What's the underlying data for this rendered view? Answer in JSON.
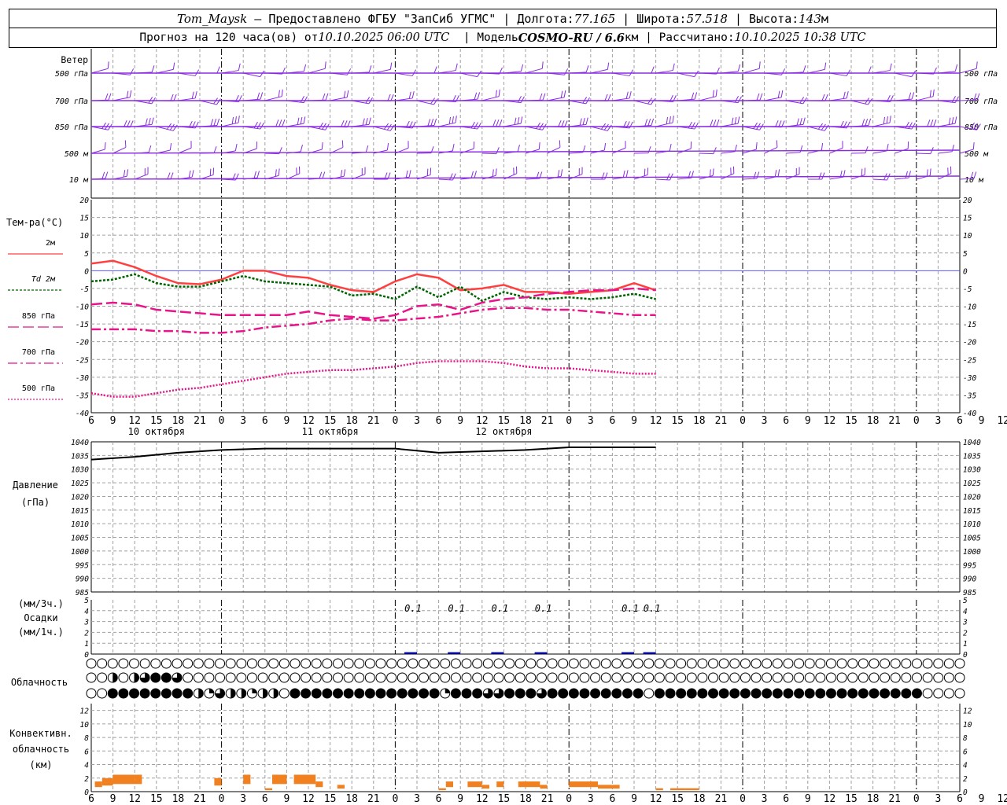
{
  "header": {
    "station": "Tom_Maysk",
    "provider": "Предоставлено ФГБУ \"ЗапСиб УГМС\"",
    "lon_label": "Долгота:",
    "lon": "77.165",
    "lat_label": "Широта:",
    "lat": "57.518",
    "alt_label": "Высота:",
    "alt": "143",
    "alt_unit": "м",
    "forecast_prefix": "Прогноз на 120 часа(ов) от",
    "forecast_time": "10.10.2025 06:00 UTC",
    "model_label": "Модель",
    "model": "COSMO-RU / 6.6",
    "model_unit": "км",
    "calc_label": "Рассчитано:",
    "calc_time": "10.10.2025 10:38 UTC"
  },
  "colors": {
    "wind": "#8a2be2",
    "t2m": "#ff4040",
    "td2m": "#006400",
    "t850": "#e8158a",
    "t700": "#e8158a",
    "t500": "#e8158a",
    "pressure": "#000000",
    "grid": "#a0a0a0",
    "zero_line": "#4040ff",
    "precip": "#0000c0",
    "convective": "#f08020"
  },
  "x_axis": {
    "start_hour": 6,
    "step_hours": 3,
    "total_hours": 120,
    "tick_labels": [
      "6",
      "9",
      "12",
      "15",
      "18",
      "21",
      "0",
      "3",
      "6",
      "9",
      "12",
      "15",
      "18",
      "21",
      "0",
      "3",
      "6",
      "9",
      "12",
      "15",
      "18",
      "21",
      "0",
      "3",
      "6",
      "9",
      "12",
      "15",
      "18",
      "21",
      "0",
      "3",
      "6",
      "9",
      "12",
      "15",
      "18",
      "21",
      "0",
      "3",
      "6",
      "9",
      "12"
    ],
    "day_labels": [
      {
        "text": "10 октября",
        "hour": 9
      },
      {
        "text": "11 октября",
        "hour": 33
      },
      {
        "text": "12 октября",
        "hour": 57
      }
    ]
  },
  "wind_panel": {
    "title": "Ветер",
    "levels": [
      "500 гПа",
      "700 гПа",
      "850 гПа",
      "500 м",
      "10  м"
    ],
    "right_levels": [
      "500 гПа",
      "700 гПа",
      "850 гПа",
      "500 м",
      "10  м"
    ]
  },
  "chart_data": [
    {
      "type": "line",
      "title": "Тем-ра(°С)",
      "ylim": [
        -40,
        20
      ],
      "yticks": [
        20,
        15,
        10,
        5,
        0,
        -5,
        -10,
        -15,
        -20,
        -25,
        -30,
        -35,
        -40
      ],
      "legend": [
        "2м",
        "Td  2м",
        "850 гПа",
        "700 гПа",
        "500 гПа"
      ],
      "hours": [
        0,
        3,
        6,
        9,
        12,
        15,
        18,
        21,
        24,
        27,
        30,
        33,
        36,
        39,
        42,
        45,
        48,
        51,
        54,
        57,
        60,
        63,
        66,
        69,
        72,
        75,
        78
      ],
      "series": [
        {
          "name": "2м",
          "values": [
            2,
            2.8,
            1,
            -1.5,
            -3.5,
            -3.8,
            -2.5,
            0,
            0,
            -1.5,
            -2,
            -4,
            -5.5,
            -6,
            -3,
            -1,
            -2,
            -5.5,
            -5,
            -4,
            -6,
            -6,
            -6.5,
            -6,
            -5.5,
            -3.5,
            -5.5
          ]
        },
        {
          "name": "Td  2м",
          "values": [
            -3,
            -2.5,
            -1,
            -3.5,
            -4.5,
            -4.5,
            -3,
            -1.5,
            -3,
            -3.5,
            -4,
            -4.5,
            -7,
            -6.5,
            -8,
            -4.5,
            -7.5,
            -4.5,
            -8.5,
            -6,
            -7.5,
            -8,
            -7.5,
            -8,
            -7.5,
            -6.5,
            -8
          ]
        },
        {
          "name": "850 гПа",
          "values": [
            -9.5,
            -9,
            -9.5,
            -11,
            -11.5,
            -12,
            -12.5,
            -12.5,
            -12.5,
            -12.5,
            -11.5,
            -12.5,
            -13,
            -13.5,
            -12.5,
            -10,
            -9.5,
            -11,
            -9,
            -8,
            -7.5,
            -6.5,
            -6,
            -5.5,
            -5.5,
            -5,
            -5.5
          ]
        },
        {
          "name": "700 гПа",
          "values": [
            -16.5,
            -16.5,
            -16.5,
            -17,
            -17,
            -17.5,
            -17.5,
            -17,
            -16,
            -15.5,
            -15,
            -14,
            -13.5,
            -14,
            -14,
            -13.5,
            -13,
            -12,
            -11,
            -10.5,
            -10.5,
            -11,
            -11,
            -11.5,
            -12,
            -12.5,
            -12.5
          ]
        },
        {
          "name": "500 гПа",
          "values": [
            -34.5,
            -35.5,
            -35.5,
            -34.5,
            -33.5,
            -33,
            -32,
            -31,
            -30,
            -29,
            -28.5,
            -28,
            -28,
            -27.5,
            -27,
            -26,
            -25.5,
            -25.5,
            -25.5,
            -26,
            -27,
            -27.5,
            -27.5,
            -28,
            -28.5,
            -29,
            -29
          ]
        }
      ]
    },
    {
      "type": "line",
      "title": "Давление",
      "unit": "(гПа)",
      "ylim": [
        985,
        1040
      ],
      "yticks": [
        1040,
        1035,
        1030,
        1025,
        1020,
        1015,
        1010,
        1005,
        1000,
        995,
        990,
        985
      ],
      "hours": [
        0,
        6,
        12,
        18,
        24,
        30,
        36,
        42,
        48,
        54,
        60,
        66,
        72,
        78
      ],
      "series": [
        {
          "name": "Давление",
          "values": [
            1033.5,
            1034.5,
            1036,
            1037,
            1037.5,
            1037.5,
            1037.5,
            1037.5,
            1036,
            1036.5,
            1037,
            1038,
            1038,
            1038
          ]
        }
      ]
    },
    {
      "type": "bar",
      "title": "Осадки",
      "ylabel_top": "(мм/3ч.)",
      "ylabel_bottom": "(мм/1ч.)",
      "ylim": [
        0,
        5
      ],
      "yticks": [
        5,
        4,
        3,
        2,
        1,
        0
      ],
      "hours": [
        45,
        51,
        57,
        63,
        75,
        78
      ],
      "values": [
        0.1,
        0.1,
        0.1,
        0.1,
        0.1,
        0.1
      ],
      "data_labels": [
        "0.1",
        "0.1",
        "0.1",
        "0.1",
        "0.1",
        "0.1"
      ]
    },
    {
      "type": "table",
      "title": "Облачность",
      "legend_note": "",
      "rows": [
        "0000000000000000000000000000000000000000000000000000000000000000000000000000000000",
        "0020234430000000000000000000000000000000000000000000000000000000000000000000000000",
        "0044444444213221220444444444444441444334443444444444044444444444444444444444440000"
      ]
    },
    {
      "type": "bar",
      "title": "Конвективн.",
      "subtitle": "облачность",
      "unit": "(км)",
      "ylim": [
        0,
        13
      ],
      "yticks": [
        12,
        10,
        8,
        6,
        4,
        2,
        0
      ],
      "segments": [
        {
          "h0": 0.5,
          "h1": 1.5,
          "top": 1.5
        },
        {
          "h0": 1.5,
          "h1": 3,
          "top": 2
        },
        {
          "h0": 3,
          "h1": 6,
          "top": 2.5
        },
        {
          "h0": 6,
          "h1": 7,
          "top": 2.5
        },
        {
          "h0": 17,
          "h1": 18,
          "top": 2
        },
        {
          "h0": 21,
          "h1": 22,
          "top": 2.5
        },
        {
          "h0": 24,
          "h1": 25,
          "top": 0.5
        },
        {
          "h0": 25,
          "h1": 27,
          "top": 2.5
        },
        {
          "h0": 28,
          "h1": 31,
          "top": 2.5
        },
        {
          "h0": 31,
          "h1": 32,
          "top": 1.5
        },
        {
          "h0": 34,
          "h1": 35,
          "top": 1
        },
        {
          "h0": 48,
          "h1": 49,
          "top": 0.5
        },
        {
          "h0": 49,
          "h1": 50,
          "top": 1.5
        },
        {
          "h0": 52,
          "h1": 54,
          "top": 1.5
        },
        {
          "h0": 54,
          "h1": 55,
          "top": 1
        },
        {
          "h0": 56,
          "h1": 57,
          "top": 1.5
        },
        {
          "h0": 59,
          "h1": 62,
          "top": 1.5
        },
        {
          "h0": 62,
          "h1": 63,
          "top": 1
        },
        {
          "h0": 66,
          "h1": 70,
          "top": 1.5
        },
        {
          "h0": 70,
          "h1": 72,
          "top": 1
        },
        {
          "h0": 72,
          "h1": 73,
          "top": 1
        },
        {
          "h0": 78,
          "h1": 79,
          "top": 0.5
        },
        {
          "h0": 80,
          "h1": 82,
          "top": 0.5
        },
        {
          "h0": 82,
          "h1": 84,
          "top": 0.5
        }
      ]
    }
  ]
}
